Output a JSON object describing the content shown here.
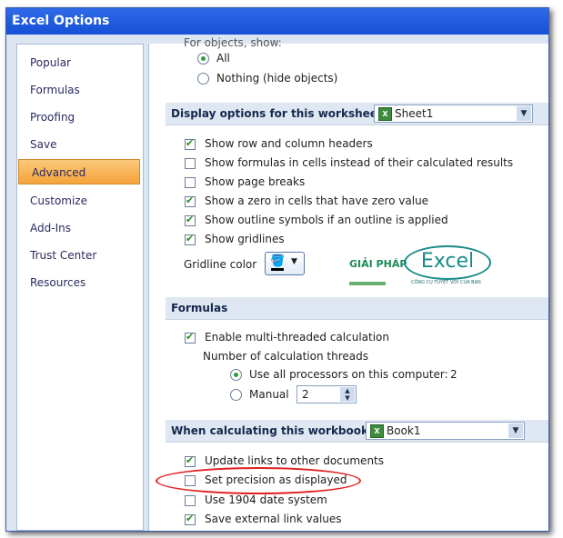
{
  "title": "Excel Options",
  "sidebar": {
    "items": [
      {
        "label": "Popular"
      },
      {
        "label": "Formulas"
      },
      {
        "label": "Proofing"
      },
      {
        "label": "Save"
      },
      {
        "label": "Advanced",
        "active": true
      },
      {
        "label": "Customize"
      },
      {
        "label": "Add-Ins"
      },
      {
        "label": "Trust Center"
      },
      {
        "label": "Resources"
      }
    ]
  },
  "objects": {
    "heading": "For objects, show:",
    "all": "All",
    "nothing": "Nothing (hide objects)"
  },
  "display": {
    "heading": "Display options for this worksheet:",
    "sheet": "Sheet1",
    "options": [
      {
        "label": "Show row and column headers",
        "checked": true
      },
      {
        "label": "Show formulas in cells instead of their calculated results",
        "checked": false
      },
      {
        "label": "Show page breaks",
        "checked": false
      },
      {
        "label": "Show a zero in cells that have zero value",
        "checked": true
      },
      {
        "label": "Show outline symbols if an outline is applied",
        "checked": true
      },
      {
        "label": "Show gridlines",
        "checked": true
      }
    ],
    "gridline_color_label": "Gridline color"
  },
  "logo": {
    "left": "GIẢI PHÁP",
    "brand": "Excel",
    "tagline": "CÔNG CỤ TUYỆT VỜI CỦA BẠN"
  },
  "formulas": {
    "heading": "Formulas",
    "multithread": "Enable multi-threaded calculation",
    "threads_label": "Number of calculation threads",
    "use_all": "Use all processors on this computer:",
    "processors": "2",
    "manual": "Manual",
    "manual_value": "2"
  },
  "workbook": {
    "heading": "When calculating this workbook:",
    "book": "Book1",
    "options": [
      {
        "label": "Update links to other documents",
        "checked": true
      },
      {
        "label": "Set precision as displayed",
        "checked": false
      },
      {
        "label": "Use 1904 date system",
        "checked": false
      },
      {
        "label": "Save external link values",
        "checked": true
      }
    ]
  },
  "highlight_color": "#e02020"
}
